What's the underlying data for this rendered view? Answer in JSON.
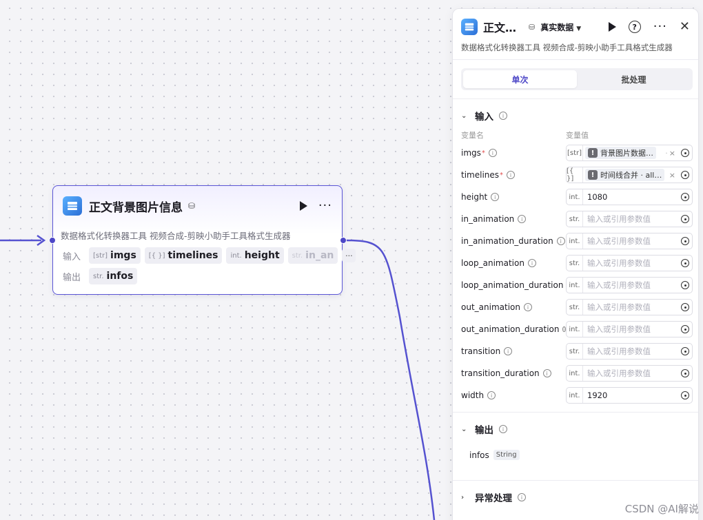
{
  "node": {
    "title": "正文背景图片信息",
    "description": "数据格式化转换器工具 视频合成-剪映小助手工具格式生成器",
    "input_label": "输入",
    "output_label": "输出",
    "inputs": [
      {
        "type": "[str]",
        "name": "imgs"
      },
      {
        "type": "[{ }]",
        "name": "timelines"
      },
      {
        "type": "int.",
        "name": "height"
      },
      {
        "type": "str.",
        "name": "in_an"
      }
    ],
    "outputs": [
      {
        "type": "str.",
        "name": "infos"
      }
    ]
  },
  "panel": {
    "title": "正文…",
    "mode": "真实数据",
    "description": "数据格式化转换器工具 视频合成-剪映小助手工具格式生成器",
    "tabs": [
      "单次",
      "批处理"
    ],
    "input_section": "输入",
    "col_name": "变量名",
    "col_value": "变量值",
    "params": [
      {
        "name": "imgs",
        "required": true,
        "type": "[str]",
        "ref": "背景图片数据…",
        "ref_suffix": "·"
      },
      {
        "name": "timelines",
        "required": true,
        "type": "[{ }]",
        "ref": "时间线合并 · all…"
      },
      {
        "name": "height",
        "type": "int.",
        "value": "1080"
      },
      {
        "name": "in_animation",
        "type": "str.",
        "placeholder": "输入或引用参数值"
      },
      {
        "name": "in_animation_duration",
        "type": "int.",
        "placeholder": "输入或引用参数值"
      },
      {
        "name": "loop_animation",
        "type": "str.",
        "placeholder": "输入或引用参数值"
      },
      {
        "name": "loop_animation_duration",
        "type": "int.",
        "placeholder": "输入或引用参数值"
      },
      {
        "name": "out_animation",
        "type": "str.",
        "placeholder": "输入或引用参数值"
      },
      {
        "name": "out_animation_duration",
        "type": "int.",
        "placeholder": "输入或引用参数值"
      },
      {
        "name": "transition",
        "type": "str.",
        "placeholder": "输入或引用参数值"
      },
      {
        "name": "transition_duration",
        "type": "int.",
        "placeholder": "输入或引用参数值"
      },
      {
        "name": "width",
        "type": "int.",
        "value": "1920"
      }
    ],
    "output_section": "输出",
    "output_item": {
      "name": "infos",
      "type": "String"
    },
    "exception_section": "异常处理"
  },
  "watermark": "CSDN @AI解说",
  "colors": {
    "accent": "#4d47c7",
    "wire": "#5552d0"
  }
}
